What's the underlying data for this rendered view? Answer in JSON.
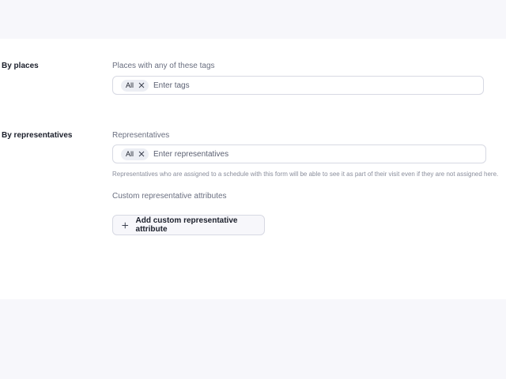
{
  "places": {
    "section_label": "By places",
    "field_label": "Places with any of these tags",
    "chip": "All",
    "placeholder": "Enter tags"
  },
  "representatives": {
    "section_label": "By representatives",
    "field_label": "Representatives",
    "chip": "All",
    "placeholder": "Enter representatives",
    "helper": "Representatives who are assigned to a schedule with this form will be able to see it as part of their visit even if they are not assigned here.",
    "custom_attributes_label": "Custom representative attributes",
    "add_button_label": "Add custom representative attribute"
  },
  "icons": {
    "chip_remove": "close-icon",
    "add": "plus-icon"
  }
}
